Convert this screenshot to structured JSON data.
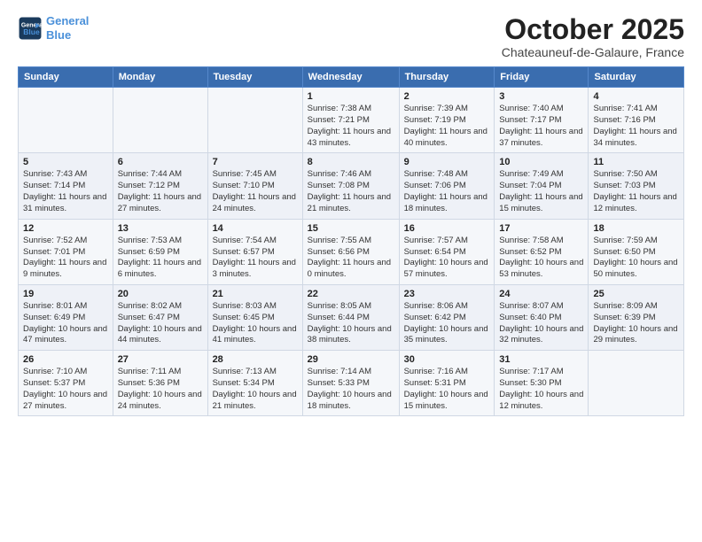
{
  "header": {
    "logo_line1": "General",
    "logo_line2": "Blue",
    "title": "October 2025",
    "subtitle": "Chateauneuf-de-Galaure, France"
  },
  "days_of_week": [
    "Sunday",
    "Monday",
    "Tuesday",
    "Wednesday",
    "Thursday",
    "Friday",
    "Saturday"
  ],
  "weeks": [
    [
      {
        "day": "",
        "info": ""
      },
      {
        "day": "",
        "info": ""
      },
      {
        "day": "",
        "info": ""
      },
      {
        "day": "1",
        "info": "Sunrise: 7:38 AM\nSunset: 7:21 PM\nDaylight: 11 hours and 43 minutes."
      },
      {
        "day": "2",
        "info": "Sunrise: 7:39 AM\nSunset: 7:19 PM\nDaylight: 11 hours and 40 minutes."
      },
      {
        "day": "3",
        "info": "Sunrise: 7:40 AM\nSunset: 7:17 PM\nDaylight: 11 hours and 37 minutes."
      },
      {
        "day": "4",
        "info": "Sunrise: 7:41 AM\nSunset: 7:16 PM\nDaylight: 11 hours and 34 minutes."
      }
    ],
    [
      {
        "day": "5",
        "info": "Sunrise: 7:43 AM\nSunset: 7:14 PM\nDaylight: 11 hours and 31 minutes."
      },
      {
        "day": "6",
        "info": "Sunrise: 7:44 AM\nSunset: 7:12 PM\nDaylight: 11 hours and 27 minutes."
      },
      {
        "day": "7",
        "info": "Sunrise: 7:45 AM\nSunset: 7:10 PM\nDaylight: 11 hours and 24 minutes."
      },
      {
        "day": "8",
        "info": "Sunrise: 7:46 AM\nSunset: 7:08 PM\nDaylight: 11 hours and 21 minutes."
      },
      {
        "day": "9",
        "info": "Sunrise: 7:48 AM\nSunset: 7:06 PM\nDaylight: 11 hours and 18 minutes."
      },
      {
        "day": "10",
        "info": "Sunrise: 7:49 AM\nSunset: 7:04 PM\nDaylight: 11 hours and 15 minutes."
      },
      {
        "day": "11",
        "info": "Sunrise: 7:50 AM\nSunset: 7:03 PM\nDaylight: 11 hours and 12 minutes."
      }
    ],
    [
      {
        "day": "12",
        "info": "Sunrise: 7:52 AM\nSunset: 7:01 PM\nDaylight: 11 hours and 9 minutes."
      },
      {
        "day": "13",
        "info": "Sunrise: 7:53 AM\nSunset: 6:59 PM\nDaylight: 11 hours and 6 minutes."
      },
      {
        "day": "14",
        "info": "Sunrise: 7:54 AM\nSunset: 6:57 PM\nDaylight: 11 hours and 3 minutes."
      },
      {
        "day": "15",
        "info": "Sunrise: 7:55 AM\nSunset: 6:56 PM\nDaylight: 11 hours and 0 minutes."
      },
      {
        "day": "16",
        "info": "Sunrise: 7:57 AM\nSunset: 6:54 PM\nDaylight: 10 hours and 57 minutes."
      },
      {
        "day": "17",
        "info": "Sunrise: 7:58 AM\nSunset: 6:52 PM\nDaylight: 10 hours and 53 minutes."
      },
      {
        "day": "18",
        "info": "Sunrise: 7:59 AM\nSunset: 6:50 PM\nDaylight: 10 hours and 50 minutes."
      }
    ],
    [
      {
        "day": "19",
        "info": "Sunrise: 8:01 AM\nSunset: 6:49 PM\nDaylight: 10 hours and 47 minutes."
      },
      {
        "day": "20",
        "info": "Sunrise: 8:02 AM\nSunset: 6:47 PM\nDaylight: 10 hours and 44 minutes."
      },
      {
        "day": "21",
        "info": "Sunrise: 8:03 AM\nSunset: 6:45 PM\nDaylight: 10 hours and 41 minutes."
      },
      {
        "day": "22",
        "info": "Sunrise: 8:05 AM\nSunset: 6:44 PM\nDaylight: 10 hours and 38 minutes."
      },
      {
        "day": "23",
        "info": "Sunrise: 8:06 AM\nSunset: 6:42 PM\nDaylight: 10 hours and 35 minutes."
      },
      {
        "day": "24",
        "info": "Sunrise: 8:07 AM\nSunset: 6:40 PM\nDaylight: 10 hours and 32 minutes."
      },
      {
        "day": "25",
        "info": "Sunrise: 8:09 AM\nSunset: 6:39 PM\nDaylight: 10 hours and 29 minutes."
      }
    ],
    [
      {
        "day": "26",
        "info": "Sunrise: 7:10 AM\nSunset: 5:37 PM\nDaylight: 10 hours and 27 minutes."
      },
      {
        "day": "27",
        "info": "Sunrise: 7:11 AM\nSunset: 5:36 PM\nDaylight: 10 hours and 24 minutes."
      },
      {
        "day": "28",
        "info": "Sunrise: 7:13 AM\nSunset: 5:34 PM\nDaylight: 10 hours and 21 minutes."
      },
      {
        "day": "29",
        "info": "Sunrise: 7:14 AM\nSunset: 5:33 PM\nDaylight: 10 hours and 18 minutes."
      },
      {
        "day": "30",
        "info": "Sunrise: 7:16 AM\nSunset: 5:31 PM\nDaylight: 10 hours and 15 minutes."
      },
      {
        "day": "31",
        "info": "Sunrise: 7:17 AM\nSunset: 5:30 PM\nDaylight: 10 hours and 12 minutes."
      },
      {
        "day": "",
        "info": ""
      }
    ]
  ]
}
